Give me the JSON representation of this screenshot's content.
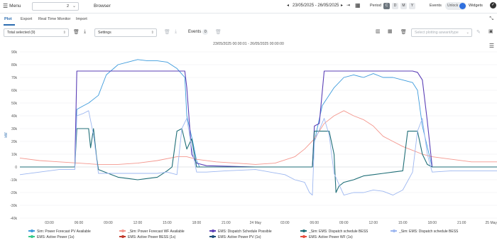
{
  "topbar": {
    "menu_label": "Menu",
    "combo_value": "2",
    "browser_label": "Browser",
    "date_range": "23/05/2025 - 26/05/2025",
    "period_label": "Period",
    "period_options": [
      "C",
      "D",
      "M",
      "Y"
    ],
    "events_label": "Events",
    "unlock_label": "Unlock",
    "widgets_label": "Widgets"
  },
  "tabs": [
    "Plot",
    "Export",
    "Real Time Monitor",
    "Import"
  ],
  "toolbar": {
    "total_selected": "Total selected (9)",
    "settings": "Settings",
    "events_label": "Events",
    "events_count": "0",
    "plotting_placeholder": "Select plotting aswant/type"
  },
  "chart_subtitle": "23/05/2025 00:00:01 - 26/05/2025 00:00:00",
  "chart_data": {
    "type": "line",
    "ylabel": "kW",
    "ylim": [
      -40,
      90
    ],
    "y_ticks": [
      "90k",
      "80k",
      "70k",
      "60k",
      "50k",
      "40k",
      "30k",
      "20k",
      "10k",
      "0",
      "-10k",
      "-20k",
      "-30k",
      "-40k"
    ],
    "x_ticks": [
      "03:00",
      "06:00",
      "09:00",
      "12:00",
      "15:00",
      "18:00",
      "21:00",
      "24 May",
      "03:00",
      "06:00",
      "09:00",
      "12:00",
      "15:00",
      "18:00",
      "21:00",
      "25 May"
    ],
    "x_hours": [
      3,
      6,
      9,
      12,
      15,
      18,
      21,
      24,
      27,
      30,
      33,
      36,
      39,
      42,
      45,
      48
    ],
    "x_range_hours": [
      0,
      48.6
    ],
    "series": [
      {
        "name": "Sim: Power Forecast PV Available",
        "color": "#3d9bdc",
        "points": [
          [
            0,
            0
          ],
          [
            5.6,
            0
          ],
          [
            5.8,
            45
          ],
          [
            6.5,
            48
          ],
          [
            7,
            50
          ],
          [
            8,
            56
          ],
          [
            8.8,
            72
          ],
          [
            10,
            80
          ],
          [
            11,
            82
          ],
          [
            12,
            84
          ],
          [
            13,
            83
          ],
          [
            14,
            83
          ],
          [
            15,
            82
          ],
          [
            16,
            77
          ],
          [
            16.8,
            70
          ],
          [
            17,
            40
          ],
          [
            17.6,
            20
          ],
          [
            18,
            5
          ],
          [
            18.3,
            0
          ],
          [
            29.8,
            0
          ],
          [
            30,
            20
          ],
          [
            30.8,
            48
          ],
          [
            32,
            62
          ],
          [
            33,
            70
          ],
          [
            34,
            72
          ],
          [
            35,
            70
          ],
          [
            36,
            73
          ],
          [
            37,
            70
          ],
          [
            38,
            70
          ],
          [
            39,
            68
          ],
          [
            40,
            66
          ],
          [
            40.5,
            60
          ],
          [
            41,
            32
          ],
          [
            41.8,
            6
          ],
          [
            42,
            0
          ],
          [
            48.6,
            0
          ]
        ]
      },
      {
        "name": "Sim: Power Forecast WF Available",
        "color": "#f4978e",
        "points": [
          [
            0,
            7
          ],
          [
            2,
            5
          ],
          [
            4,
            4
          ],
          [
            6,
            3
          ],
          [
            8,
            2
          ],
          [
            10,
            2
          ],
          [
            12,
            3
          ],
          [
            14,
            5
          ],
          [
            16,
            8
          ],
          [
            17,
            8
          ],
          [
            18,
            6
          ],
          [
            20,
            4
          ],
          [
            22,
            3
          ],
          [
            24,
            2
          ],
          [
            26,
            3
          ],
          [
            28,
            8
          ],
          [
            29,
            14
          ],
          [
            30,
            22
          ],
          [
            31,
            34
          ],
          [
            32,
            40
          ],
          [
            33,
            44
          ],
          [
            34,
            40
          ],
          [
            35,
            37
          ],
          [
            36,
            32
          ],
          [
            37,
            24
          ],
          [
            38,
            20
          ],
          [
            39,
            16
          ],
          [
            40,
            13
          ],
          [
            41,
            10
          ],
          [
            42,
            8
          ],
          [
            44,
            6
          ],
          [
            46,
            4
          ],
          [
            48.6,
            4
          ]
        ]
      },
      {
        "name": "EMS: Dispatch Schedule Possible",
        "color": "#5b3fb6",
        "points": [
          [
            0,
            0
          ],
          [
            5.6,
            0
          ],
          [
            5.8,
            75
          ],
          [
            16.8,
            75
          ],
          [
            17,
            62
          ],
          [
            17.5,
            10
          ],
          [
            18,
            3
          ],
          [
            19,
            1
          ],
          [
            24,
            0
          ],
          [
            27,
            0
          ],
          [
            29.8,
            0
          ],
          [
            30,
            32
          ],
          [
            30.5,
            34
          ],
          [
            31,
            75
          ],
          [
            40,
            75
          ],
          [
            40.5,
            74
          ],
          [
            41,
            68
          ],
          [
            41.5,
            36
          ],
          [
            42,
            0
          ],
          [
            48.6,
            0
          ]
        ]
      },
      {
        "name": "Sim: EMS: Dispatch schedule BESS",
        "color": "#1f6e77",
        "points": [
          [
            0,
            0
          ],
          [
            5.6,
            0
          ],
          [
            5.8,
            30
          ],
          [
            7,
            30
          ],
          [
            7.2,
            15
          ],
          [
            7.5,
            30
          ],
          [
            7.8,
            8
          ],
          [
            8,
            -2
          ],
          [
            9,
            -5
          ],
          [
            10,
            -8
          ],
          [
            11,
            -9
          ],
          [
            12,
            -10
          ],
          [
            13,
            -9
          ],
          [
            14,
            -8
          ],
          [
            15,
            -3
          ],
          [
            15.5,
            0
          ],
          [
            16,
            28
          ],
          [
            16.5,
            30
          ],
          [
            17,
            14
          ],
          [
            17.5,
            22
          ],
          [
            18,
            0
          ],
          [
            29.8,
            0
          ],
          [
            30,
            28
          ],
          [
            31.5,
            28
          ],
          [
            32,
            10
          ],
          [
            32.2,
            -20
          ],
          [
            32.5,
            -15
          ],
          [
            33,
            -12
          ],
          [
            34,
            -10
          ],
          [
            35,
            -7
          ],
          [
            36,
            -6
          ],
          [
            37,
            -5
          ],
          [
            38,
            -4
          ],
          [
            39,
            -3
          ],
          [
            39.5,
            28
          ],
          [
            40.5,
            28
          ],
          [
            41,
            10
          ],
          [
            41.5,
            2
          ],
          [
            42,
            0
          ],
          [
            48.6,
            0
          ]
        ]
      },
      {
        "name": "Sim: EMS: Dispatch schedule BESS",
        "color": "#9db7f0",
        "points": [
          [
            0,
            -6
          ],
          [
            2,
            -4
          ],
          [
            4,
            -2
          ],
          [
            5.6,
            -2
          ],
          [
            5.8,
            40
          ],
          [
            6.5,
            42
          ],
          [
            7,
            44
          ],
          [
            7.5,
            25
          ],
          [
            8,
            -5
          ],
          [
            9,
            -5
          ],
          [
            10,
            -5
          ],
          [
            12,
            -5
          ],
          [
            14,
            -5
          ],
          [
            15,
            -4
          ],
          [
            16,
            -6
          ],
          [
            16.5,
            30
          ],
          [
            17,
            38
          ],
          [
            17.5,
            15
          ],
          [
            18,
            -4
          ],
          [
            19,
            -4
          ],
          [
            21,
            -3
          ],
          [
            24,
            -2
          ],
          [
            27,
            -6
          ],
          [
            28,
            -10
          ],
          [
            29,
            -12
          ],
          [
            29.5,
            -20
          ],
          [
            29.8,
            -22
          ],
          [
            30,
            20
          ],
          [
            31,
            38
          ],
          [
            31.5,
            25
          ],
          [
            32,
            -5
          ],
          [
            33,
            -22
          ],
          [
            34,
            -20
          ],
          [
            35,
            -20
          ],
          [
            36,
            -18
          ],
          [
            37,
            -19
          ],
          [
            38,
            -22
          ],
          [
            39,
            -18
          ],
          [
            40,
            -4
          ],
          [
            40.5,
            28
          ],
          [
            41,
            38
          ],
          [
            41.5,
            10
          ],
          [
            42,
            -4
          ],
          [
            44,
            -3
          ],
          [
            46,
            -3
          ],
          [
            48.6,
            -3
          ]
        ]
      },
      {
        "name": "EMS: Active Power (1s)",
        "color": "#36c98a",
        "points": []
      },
      {
        "name": "EMS: Active Power BESS (1s)",
        "color": "#c0392b",
        "points": []
      },
      {
        "name": "EMS: Active Power PV (1s)",
        "color": "#1f4e79",
        "points": []
      },
      {
        "name": "EMS: Active Power WF (1s)",
        "color": "#e74c3c",
        "points": []
      }
    ]
  },
  "legend": [
    "Sim: Power Forecast PV Available",
    "_Sim: Power Forecast WF Available",
    "EMS: Dispatch Schedule Possible",
    "_Sim: EMS: Dispatch schedule BESS",
    "_Sim: EMS: Dispatch schedule BESS",
    "EMS: Active Power (1s)",
    "EMS: Active Power BESS (1s)",
    "EMS: Active Power PV (1s)",
    "EMS: Active Power WF (1s)"
  ],
  "colors": {
    "accent": "#2b6cb0"
  }
}
